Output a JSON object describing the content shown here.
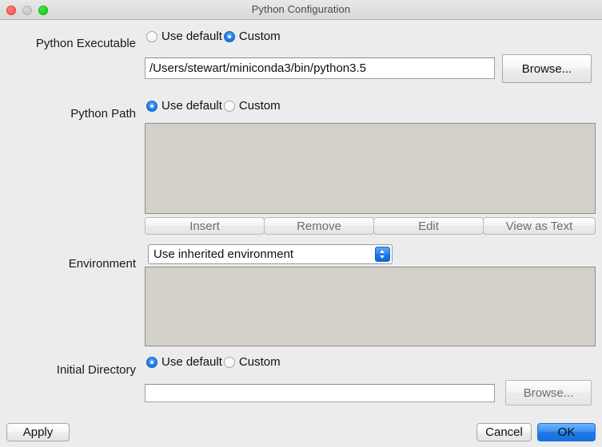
{
  "window": {
    "title": "Python Configuration",
    "traffic_lights": {
      "close": "close-button",
      "minimize": "minimize-button",
      "maximize": "maximize-button"
    }
  },
  "rows": {
    "python_executable": {
      "label": "Python Executable",
      "options": [
        {
          "label": "Use default",
          "selected": false
        },
        {
          "label": "Custom",
          "selected": true
        }
      ],
      "path_value": "/Users/stewart/miniconda3/bin/python3.5",
      "browse_label": "Browse...",
      "browse_enabled": true
    },
    "python_path": {
      "label": "Python Path",
      "options": [
        {
          "label": "Use default",
          "selected": true
        },
        {
          "label": "Custom",
          "selected": false
        }
      ],
      "list_items": [],
      "buttons": [
        {
          "label": "Insert",
          "enabled": false
        },
        {
          "label": "Remove",
          "enabled": false
        },
        {
          "label": "Edit",
          "enabled": false
        },
        {
          "label": "View as Text",
          "enabled": false
        }
      ]
    },
    "environment": {
      "label": "Environment",
      "selected_option": "Use inherited environment",
      "options": [
        "Use inherited environment"
      ],
      "list_items": []
    },
    "initial_directory": {
      "label": "Initial Directory",
      "options": [
        {
          "label": "Use default",
          "selected": true
        },
        {
          "label": "Custom",
          "selected": false
        }
      ],
      "path_value": "",
      "browse_label": "Browse...",
      "browse_enabled": false
    }
  },
  "footer": {
    "apply_label": "Apply",
    "cancel_label": "Cancel",
    "ok_label": "OK"
  }
}
